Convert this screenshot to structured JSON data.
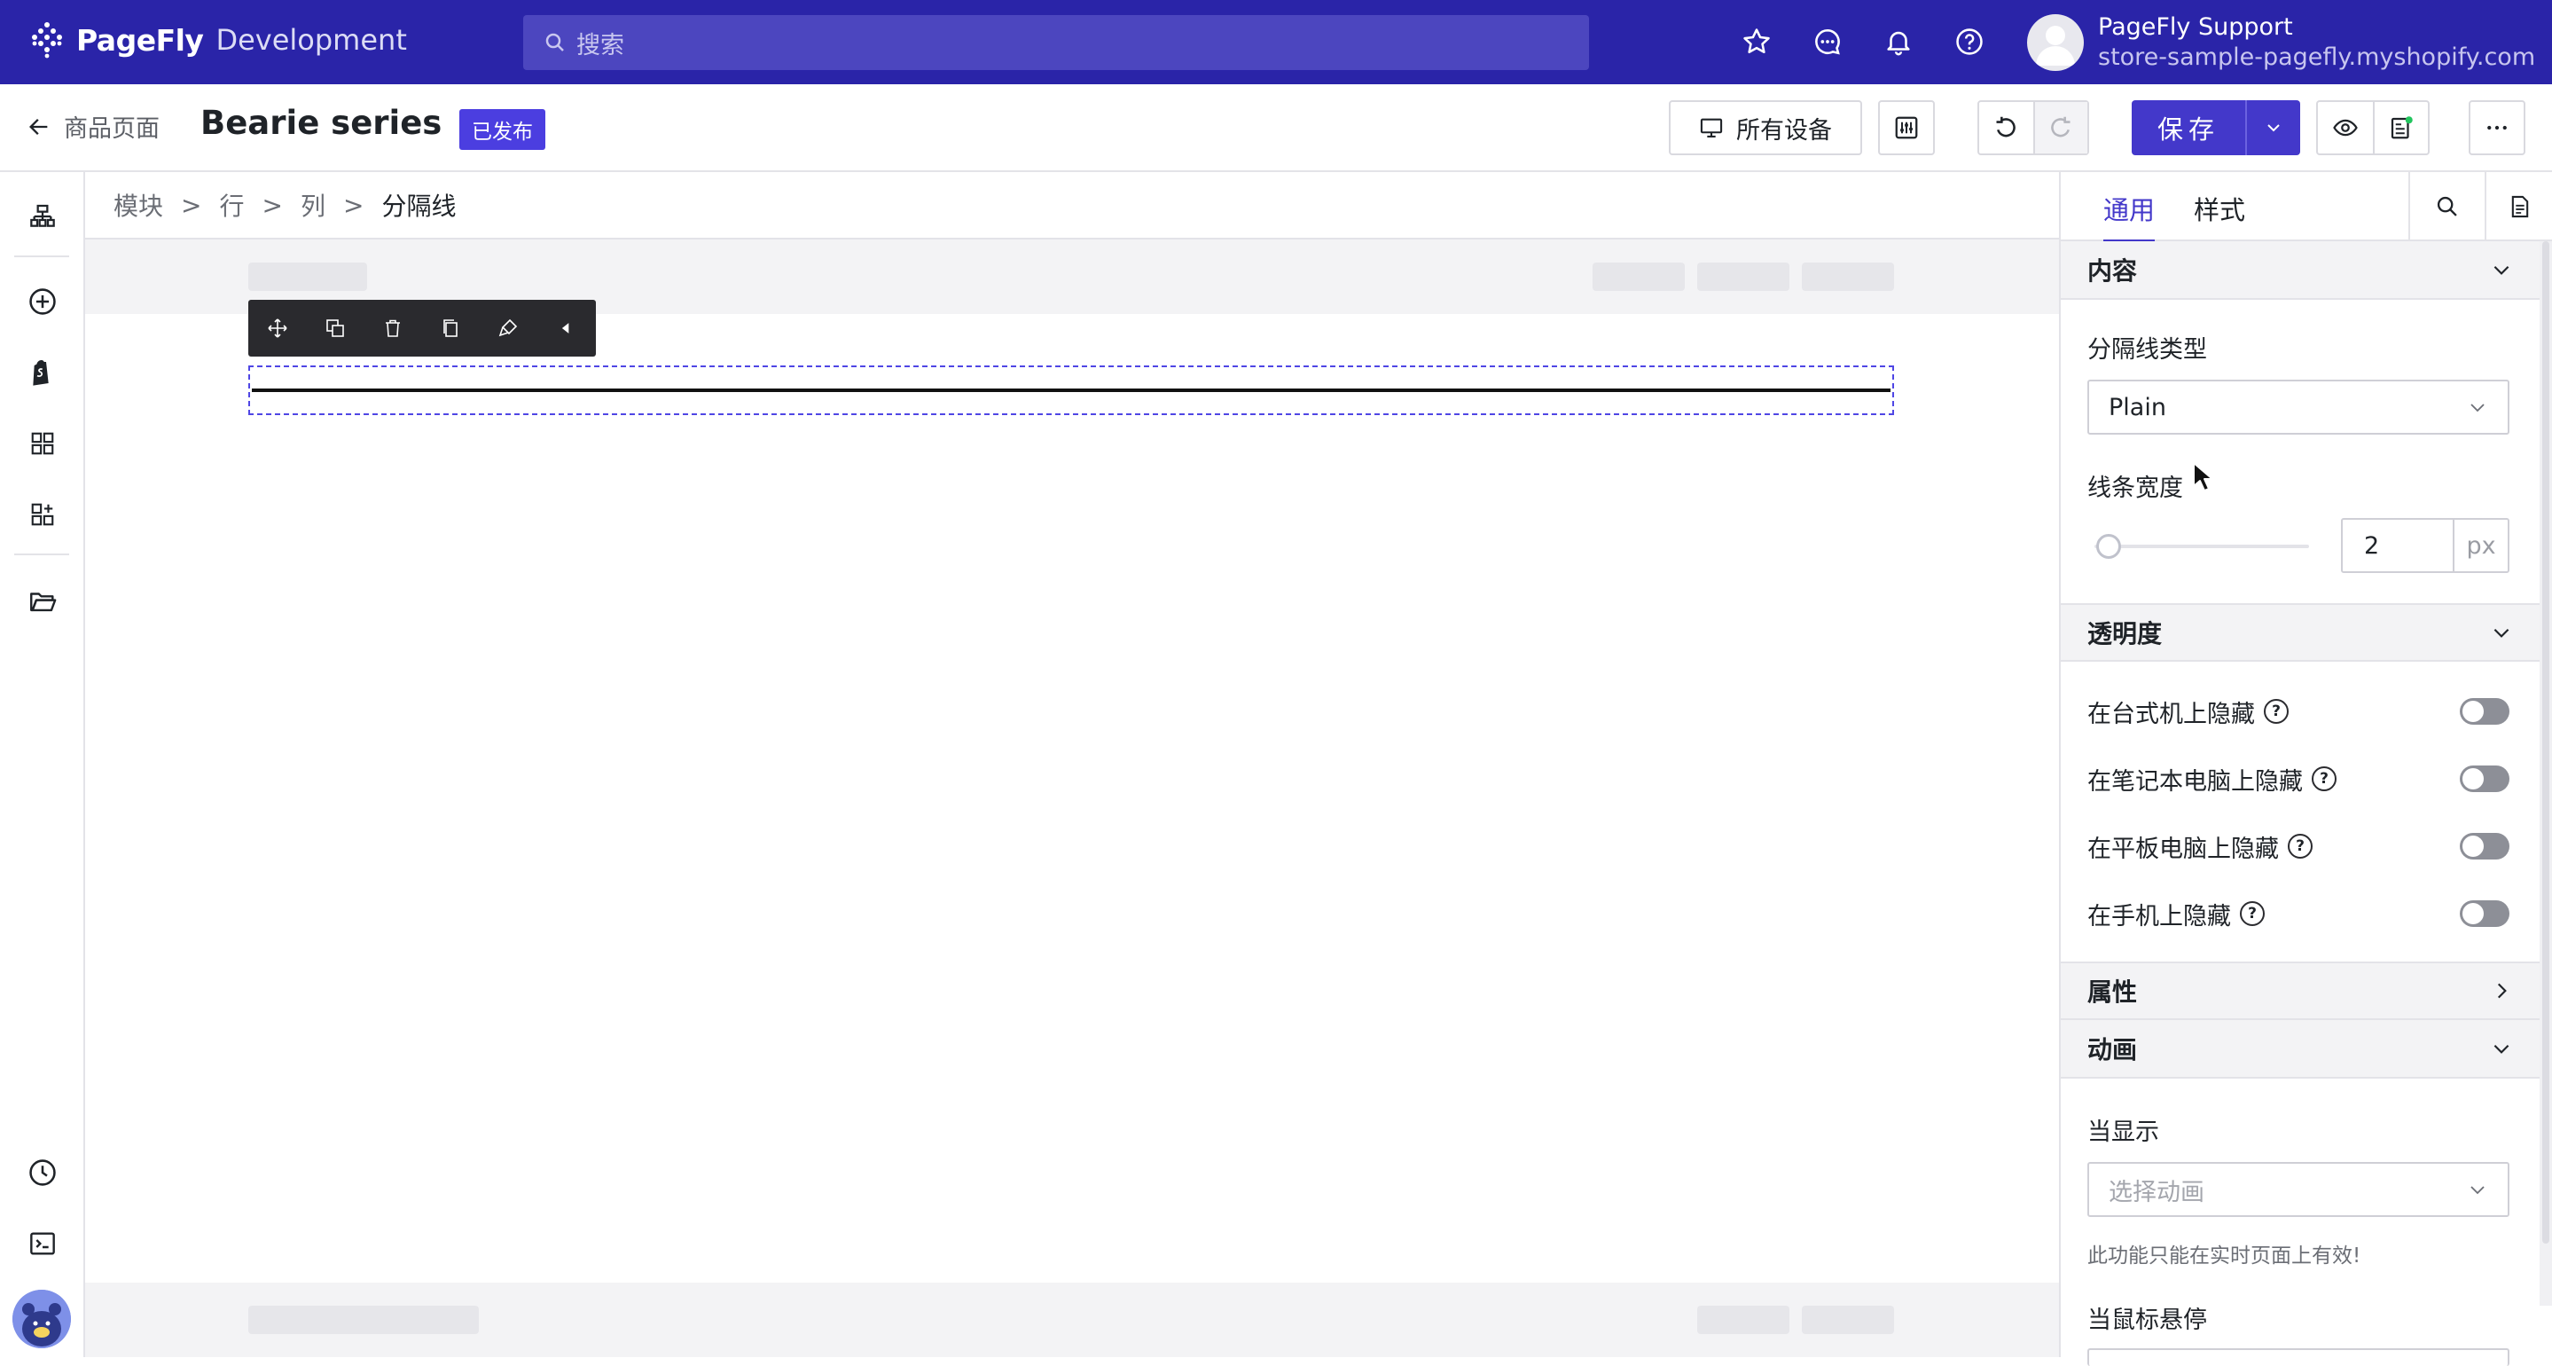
{
  "app": {
    "brand_name": "PageFly",
    "brand_env": "Development",
    "search_placeholder": "搜索",
    "user_name": "PageFly Support",
    "user_store": "store-sample-pagefly.myshopify.com"
  },
  "header": {
    "back_label": "商品页面",
    "page_title": "Bearie series",
    "status_badge": "已发布",
    "devices_label": "所有设备",
    "save_label": "保存"
  },
  "breadcrumb": {
    "items": [
      "模块",
      "行",
      "列"
    ],
    "current": "分隔线",
    "separator": ">"
  },
  "panel": {
    "tabs": [
      "通用",
      "样式"
    ],
    "active_tab": "通用",
    "sections": {
      "content": "内容",
      "opacity": "透明度",
      "attributes": "属性",
      "animation": "动画"
    },
    "divider_type_label": "分隔线类型",
    "divider_type_value": "Plain",
    "line_width_label": "线条宽度",
    "line_width_value": "2",
    "line_width_unit": "px",
    "hide_rows": [
      "在台式机上隐藏",
      "在笔记本电脑上隐藏",
      "在平板电脑上隐藏",
      "在手机上隐藏"
    ],
    "on_show_label": "当显示",
    "animation_placeholder": "选择动画",
    "animation_note": "此功能只能在实时页面上有效!",
    "on_hover_label": "当鼠标悬停"
  },
  "colors": {
    "topbar": "#2a24a8",
    "accent": "#4338ca",
    "badge": "#4b3ee0",
    "selection": "#4f46e5"
  }
}
